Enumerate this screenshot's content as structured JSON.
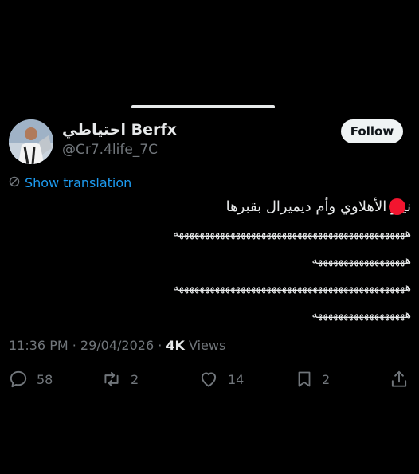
{
  "user": {
    "display_name": "احتياطي Berfx",
    "handle": "@Cr7.4life_7C",
    "follow_label": "Follow"
  },
  "translation_label": "Show translation",
  "tweet": {
    "line1": "نيـو الأهلاوي وأم ديميرال بقبرها",
    "line2": "هههههههههههههههههههههههههههههههههههههههههههههه",
    "line3": "ههههههههههههههههههه",
    "line4": "هههههههههههههههههههههههههههههههههههههههههههههه",
    "line5": "ههههههههههههههههههه"
  },
  "meta": {
    "time_date": "11:36 PM · 29/04/2026 · ",
    "views_count": "4K",
    "views_label": " Views"
  },
  "actions": {
    "replies": "58",
    "reposts": "2",
    "likes": "14",
    "bookmarks": "2"
  },
  "colors": {
    "background": "#000000",
    "text": "#e7e9ea",
    "muted": "#71767b",
    "link": "#1d9bf0",
    "follow_bg": "#eff3f4",
    "red_dot": "#f2152f"
  },
  "icons": [
    "translate-icon",
    "reply-icon",
    "repost-icon",
    "like-icon",
    "bookmark-icon",
    "share-icon"
  ]
}
